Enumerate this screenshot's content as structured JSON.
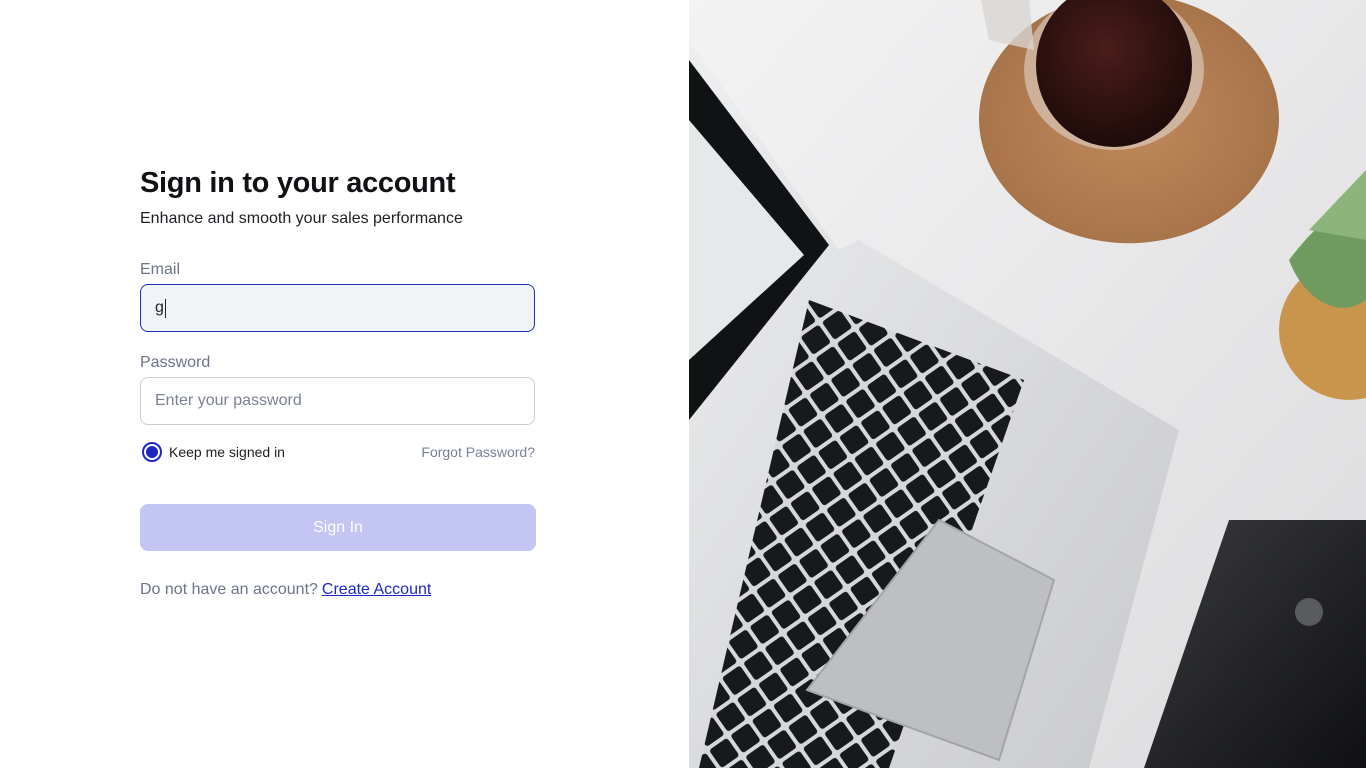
{
  "form": {
    "title": "Sign in to your account",
    "subtitle": "Enhance and smooth your sales performance",
    "email_label": "Email",
    "email_value": "g",
    "password_label": "Password",
    "password_placeholder": "Enter your password",
    "keep_signed_in_label": "Keep me signed in",
    "keep_signed_in_checked": true,
    "forgot_password": "Forgot Password?",
    "sign_in_button": "Sign In",
    "footer_text": "Do not have an account?",
    "create_account_link": "Create Account"
  },
  "colors": {
    "accent": "#1b28c4",
    "button_disabled": "#c3c5f3",
    "muted_text": "#6b7489"
  },
  "hero_image": {
    "description_icons": [
      "laptop",
      "coffee-cup",
      "cork-coaster",
      "succulent-plant",
      "smartphone"
    ]
  }
}
